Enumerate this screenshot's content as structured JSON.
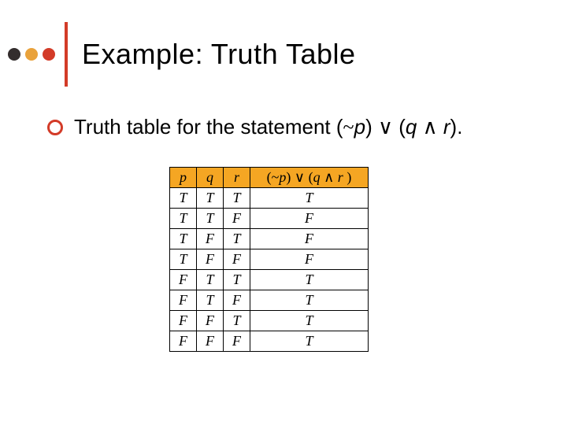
{
  "title": "Example:  Truth Table",
  "body": {
    "prefix": "Truth table for the statement (",
    "neg": "~",
    "p": "p",
    "mid1": ") ",
    "or": "∨",
    "mid2": " (",
    "q": "q",
    "mid3": " ",
    "and": "∧",
    "mid4": " ",
    "r": "r",
    "suffix": ")."
  },
  "chart_data": {
    "type": "table",
    "headers": {
      "c0": "p",
      "c1": "q",
      "c2": "r",
      "c3_parts": {
        "open": "(",
        "neg": "~",
        "p": "p",
        "mid1": ") ",
        "or": "∨",
        "mid2": " (",
        "q": "q",
        "mid3": " ",
        "and": "∧",
        "mid4": " ",
        "r": "r ",
        "close": ")"
      }
    },
    "rows": [
      {
        "p": "T",
        "q": "T",
        "r": "T",
        "res": "T"
      },
      {
        "p": "T",
        "q": "T",
        "r": "F",
        "res": "F"
      },
      {
        "p": "T",
        "q": "F",
        "r": "T",
        "res": "F"
      },
      {
        "p": "T",
        "q": "F",
        "r": "F",
        "res": "F"
      },
      {
        "p": "F",
        "q": "T",
        "r": "T",
        "res": "T"
      },
      {
        "p": "F",
        "q": "T",
        "r": "F",
        "res": "T"
      },
      {
        "p": "F",
        "q": "F",
        "r": "T",
        "res": "T"
      },
      {
        "p": "F",
        "q": "F",
        "r": "F",
        "res": "T"
      }
    ]
  }
}
